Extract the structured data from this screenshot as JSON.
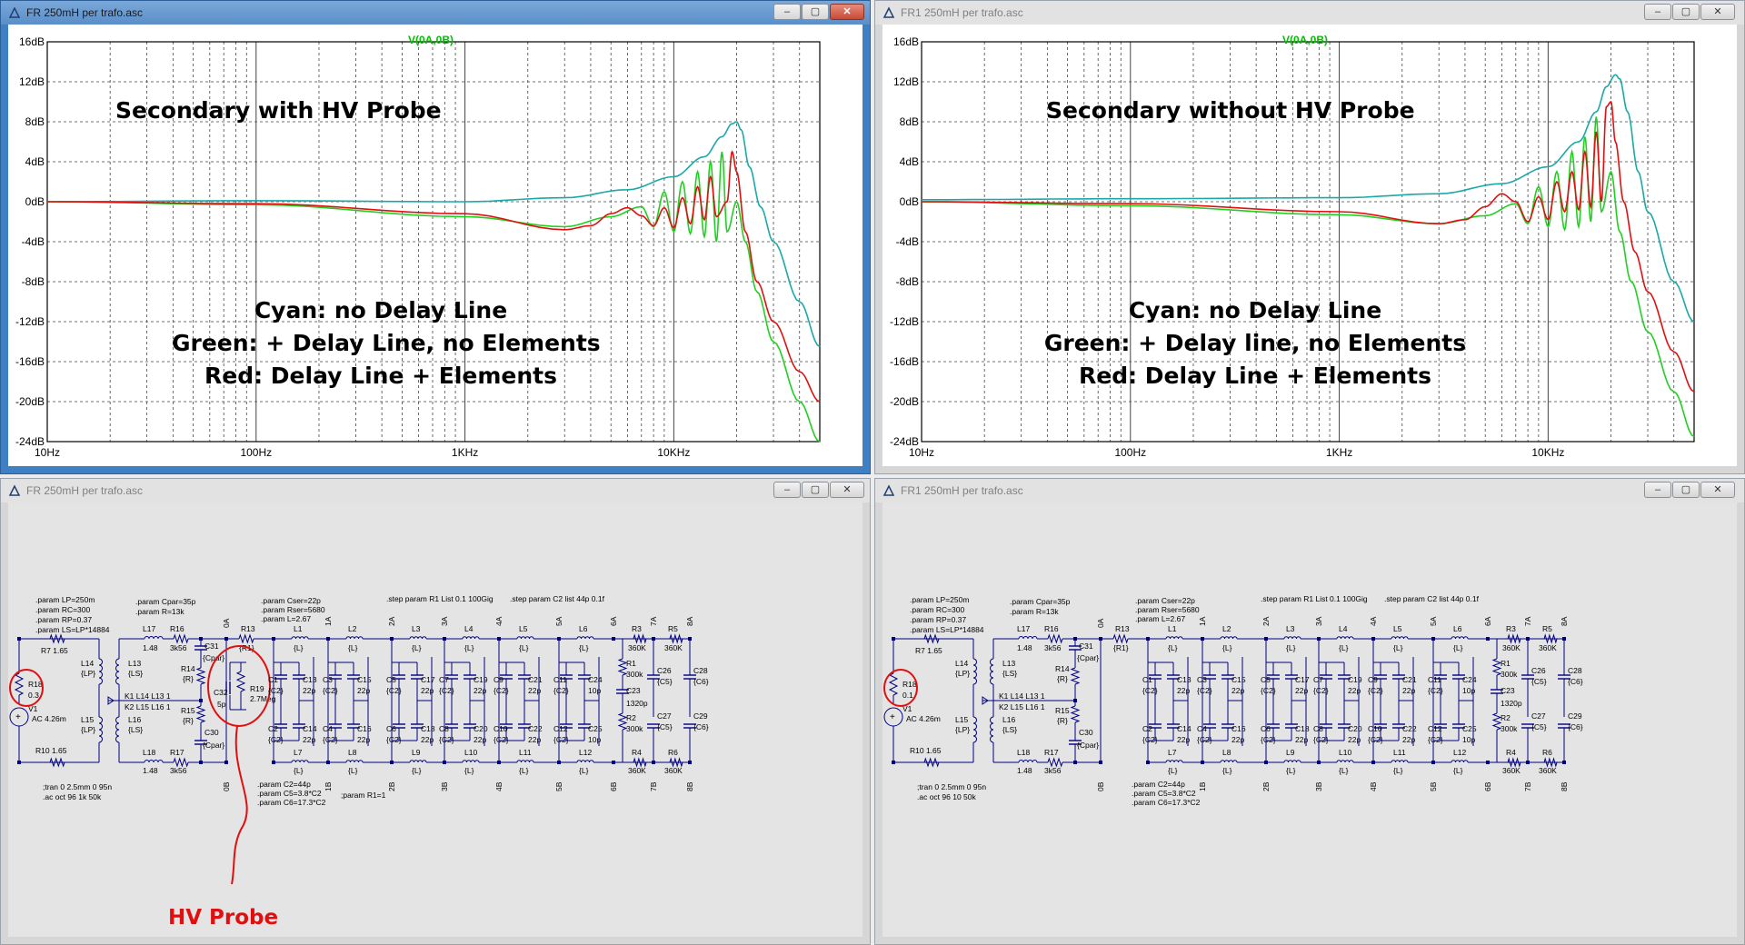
{
  "windows": {
    "plot_left": {
      "title": "FR 250mH per trafo.asc"
    },
    "plot_right": {
      "title": "FR1 250mH per trafo.asc"
    },
    "schem_left": {
      "title": "FR 250mH per trafo.asc"
    },
    "schem_right": {
      "title": "FR1 250mH per trafo.asc"
    }
  },
  "buttons": {
    "minimize": "–",
    "maximize": "▢",
    "close": "✕"
  },
  "plots": {
    "trace_name": "V(0A,0B)",
    "left_heading": "Secondary with HV Probe",
    "right_heading": "Secondary without HV Probe",
    "left_legend": [
      "Cyan: no Delay Line",
      "Green: + Delay Line, no Elements",
      "Red: Delay Line + Elements"
    ],
    "right_legend": [
      "Cyan: no Delay Line",
      "Green: + Delay line, no Elements",
      "Red: Delay Line + Elements"
    ]
  },
  "chart_data": [
    {
      "type": "line",
      "xlabel": "",
      "ylabel": "",
      "x_scale": "log",
      "xlim": [
        10,
        50000
      ],
      "ylim": [
        -24,
        16
      ],
      "x_ticks": [
        "10Hz",
        "100Hz",
        "1KHz",
        "10KHz"
      ],
      "y_ticks": [
        "16dB",
        "12dB",
        "8dB",
        "4dB",
        "0dB",
        "-4dB",
        "-8dB",
        "-12dB",
        "-16dB",
        "-20dB",
        "-24dB"
      ],
      "grid": true,
      "series": [
        {
          "name": "Cyan: no Delay Line",
          "color": "#1aa8a8",
          "x": [
            10,
            100,
            1000,
            3000,
            6000,
            10000,
            14000,
            17000,
            19000,
            20000,
            21000,
            23000,
            26000,
            30000,
            40000,
            50000
          ],
          "y": [
            0,
            0.1,
            0,
            0.4,
            1.2,
            2.5,
            4.5,
            6.5,
            7.8,
            8.0,
            7.2,
            3.5,
            -0.5,
            -4,
            -10,
            -14.5
          ]
        },
        {
          "name": "Green: + Delay Line, no Elements",
          "color": "#20d020",
          "x": [
            10,
            100,
            1000,
            3000,
            5000,
            7000,
            8000,
            9000,
            10000,
            11000,
            12000,
            13000,
            14000,
            15000,
            16000,
            17000,
            18000,
            20000,
            22000,
            25000,
            30000,
            40000,
            50000
          ],
          "y": [
            0,
            -0.3,
            -1.5,
            -2.5,
            -1.5,
            -0.5,
            -2.5,
            1,
            -3,
            2,
            -3.2,
            3,
            -3.5,
            4,
            -4,
            5,
            -3,
            0,
            -4,
            -9,
            -14,
            -20,
            -24
          ]
        },
        {
          "name": "Red: Delay Line + Elements",
          "color": "#e01010",
          "x": [
            10,
            100,
            1000,
            3000,
            4000,
            5000,
            6000,
            7000,
            8000,
            9000,
            10000,
            11000,
            12000,
            13000,
            14000,
            15000,
            16000,
            18000,
            19000,
            20000,
            22000,
            25000,
            30000,
            40000,
            50000
          ],
          "y": [
            0,
            -0.2,
            -1.2,
            -2.8,
            -2.4,
            -1.2,
            -0.6,
            -1.4,
            -2.4,
            -0.6,
            -2.6,
            0.4,
            -2.2,
            1.5,
            -1.8,
            2.5,
            -1.5,
            0,
            5,
            3,
            -3,
            -8,
            -12,
            -17,
            -20
          ]
        }
      ]
    },
    {
      "type": "line",
      "xlabel": "",
      "ylabel": "",
      "x_scale": "log",
      "xlim": [
        10,
        50000
      ],
      "ylim": [
        -24,
        16
      ],
      "x_ticks": [
        "10Hz",
        "100Hz",
        "1KHz",
        "10KHz"
      ],
      "y_ticks": [
        "16dB",
        "12dB",
        "8dB",
        "4dB",
        "0dB",
        "-4dB",
        "-8dB",
        "-12dB",
        "-16dB",
        "-20dB",
        "-24dB"
      ],
      "grid": true,
      "series": [
        {
          "name": "Cyan: no Delay Line",
          "color": "#1aa8a8",
          "x": [
            10,
            100,
            1000,
            3000,
            6000,
            10000,
            14000,
            17000,
            19000,
            21000,
            22000,
            24000,
            27000,
            30000,
            40000,
            50000
          ],
          "y": [
            0.2,
            0.3,
            0.4,
            0.8,
            1.8,
            3.5,
            6,
            9,
            11.5,
            12.7,
            12.3,
            9,
            3,
            -1,
            -8,
            -12
          ]
        },
        {
          "name": "Green: + Delay line, no Elements",
          "color": "#20d020",
          "x": [
            10,
            100,
            1000,
            3000,
            5000,
            7000,
            8000,
            9000,
            10000,
            11000,
            12000,
            13000,
            14000,
            15000,
            16000,
            17000,
            18000,
            20000,
            22000,
            25000,
            30000,
            40000,
            50000
          ],
          "y": [
            0,
            -0.4,
            -1.3,
            -2.2,
            -1.4,
            -0.2,
            -2.2,
            1.5,
            -2.5,
            3,
            -2.8,
            5,
            -2.5,
            6.5,
            -2,
            8.5,
            -1,
            3,
            -3,
            -8,
            -13,
            -19,
            -23.5
          ]
        },
        {
          "name": "Red: Delay Line + Elements",
          "color": "#e01010",
          "x": [
            10,
            100,
            1000,
            3000,
            4000,
            5000,
            6000,
            7000,
            8000,
            9000,
            10000,
            11000,
            12000,
            13000,
            14000,
            15000,
            16000,
            17000,
            18000,
            19000,
            20000,
            21000,
            23000,
            26000,
            30000,
            40000,
            50000
          ],
          "y": [
            0,
            -0.2,
            -1,
            -2.2,
            -1.8,
            -0.5,
            0.8,
            0,
            -2,
            0.5,
            -1.8,
            2,
            -1,
            3,
            -0.8,
            5,
            -0.5,
            7,
            0,
            9.5,
            10,
            6,
            0,
            -5,
            -9,
            -15,
            -19
          ]
        }
      ]
    }
  ],
  "schematic": {
    "params_left": [
      ".param LP=250m",
      ".param RC=300",
      ".param RP=0.37",
      ".param LS=LP*14884"
    ],
    "params_mid": [
      ".param Cpar=35p",
      ".param R=13k"
    ],
    "params_c": [
      ".param Cser=22p",
      ".param Rser=5680",
      ".param L=2.67"
    ],
    "step1": ".step param R1 List 0.1 100Gig",
    "step2": ".step param C2 list 44p 0.1f",
    "params_bottom": [
      ".param C2=44p",
      ".param C5=3.8*C2",
      ".param C6=17.3*C2"
    ],
    "param_r1": ";param R1=1",
    "tran": ";tran 0 2.5mm 0 95n",
    "ac_left": ".ac oct 96 1k 50k",
    "ac_right": ".ac oct 96 10 50k",
    "source": "AC 4.26m",
    "v1": "V1",
    "r18": "R18",
    "r18_val_left": "0.3",
    "r18_val_right": "0.1",
    "r7": "R7  1.65",
    "r10": "R10   1.65",
    "l14": "L14",
    "l14_val": "{LP}",
    "l15": "L15",
    "l15_val": "{LP}",
    "l13": "L13",
    "l13_val": "{LS}",
    "l16": "L16",
    "l16_val": "{LS}",
    "k1": "K1 L14 L13 1",
    "k2": "K2 L15 L16 1",
    "l17": "L17",
    "l17_val": "1.48",
    "r16": "R16",
    "r16_val": "3k56",
    "l18": "L18",
    "l18_val": "1.48",
    "r17": "R17",
    "r17_val": "3k56",
    "c31": "C31",
    "c31_val": "{Cpar}",
    "c30": "C30",
    "c30_val": "{Cpar}",
    "r14": "R14",
    "r14_val": "{R}",
    "r15": "R15",
    "r15_val": "{R}",
    "r13": "R13",
    "r13_val": "{R1}",
    "c32": "C32",
    "c32_val": "5p",
    "r19": "R19",
    "r19_val": "2.7Meg",
    "node_0a": "0A",
    "node_0b": "0B",
    "hv_probe": "HV Probe",
    "nodes_top": [
      "1A",
      "2A",
      "3A",
      "4A",
      "5A",
      "6A",
      "7A",
      "8A"
    ],
    "nodes_bot": [
      "1B",
      "2B",
      "3B",
      "4B",
      "5B",
      "6B",
      "7B",
      "8B"
    ],
    "l_top": [
      "L1",
      "L2",
      "L3",
      "L4",
      "L5",
      "L6"
    ],
    "l_bot": [
      "L7",
      "L8",
      "L9",
      "L10",
      "L11",
      "L12"
    ],
    "l_val": "{L}",
    "c_pairs_top": [
      [
        "C1",
        "C13"
      ],
      [
        "C3",
        "C15"
      ],
      [
        "C5",
        "C17"
      ],
      [
        "C7",
        "C19"
      ],
      [
        "C9",
        "C21"
      ],
      [
        "C11",
        "C24"
      ]
    ],
    "c_pairs_bot": [
      [
        "C2",
        "C14"
      ],
      [
        "C4",
        "C16"
      ],
      [
        "C6",
        "C18"
      ],
      [
        "C8",
        "C20"
      ],
      [
        "C10",
        "C22"
      ],
      [
        "C12",
        "C25"
      ]
    ],
    "c_val_a": "{C2}",
    "c_val_b": "22p",
    "c_val_10p": "10p",
    "r3": "R3",
    "r3_val": "360K",
    "r5": "R5",
    "r5_val": "360K",
    "r4": "R4",
    "r4_val": "360K",
    "r6": "R6",
    "r6_val": "360K",
    "r1": "R1",
    "r1_val": "300k",
    "r2": "R2",
    "r2_val": "300k",
    "c23": "C23",
    "c23_val": "1320p",
    "c26": "C26",
    "c26_val": "{C5}",
    "c27": "C27",
    "c27_val": "{C5}",
    "c28": "C28",
    "c28_val": "{C6}",
    "c29": "C29",
    "c29_val": "{C6}"
  }
}
